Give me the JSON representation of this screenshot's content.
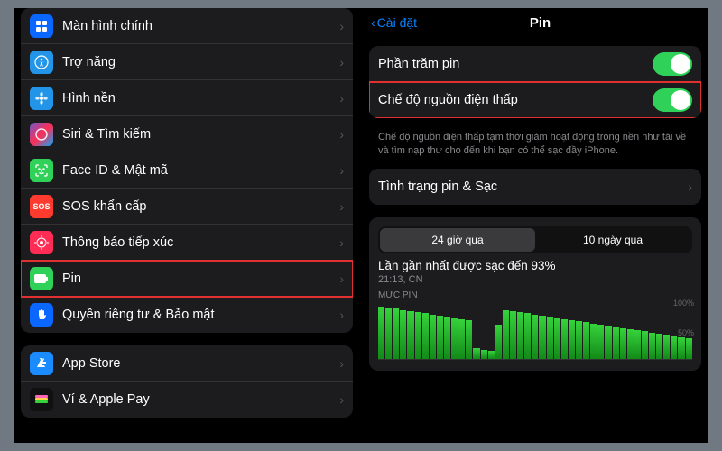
{
  "left": {
    "items": [
      {
        "label": "Màn hình chính",
        "icon": "home-grid",
        "bg": "ic-blue"
      },
      {
        "label": "Trợ năng",
        "icon": "accessibility",
        "bg": "ic-teal"
      },
      {
        "label": "Hình nền",
        "icon": "flower",
        "bg": "ic-teal"
      },
      {
        "label": "Siri & Tìm kiếm",
        "icon": "siri",
        "bg": "ic-siri"
      },
      {
        "label": "Face ID & Mật mã",
        "icon": "faceid",
        "bg": "ic-green"
      },
      {
        "label": "SOS khẩn cấp",
        "icon": "sos",
        "bg": "ic-red",
        "text": "SOS"
      },
      {
        "label": "Thông báo tiếp xúc",
        "icon": "exposure",
        "bg": "ic-pink"
      },
      {
        "label": "Pin",
        "icon": "battery",
        "bg": "ic-green",
        "highlight": true
      },
      {
        "label": "Quyền riêng tư & Bảo mật",
        "icon": "hand",
        "bg": "ic-bluehand"
      }
    ],
    "group2": [
      {
        "label": "App Store",
        "icon": "appstore",
        "bg": "ic-appstore"
      },
      {
        "label": "Ví & Apple Pay",
        "icon": "wallet",
        "bg": "ic-black"
      }
    ]
  },
  "right": {
    "back": "Cài đặt",
    "title": "Pin",
    "toggles": [
      {
        "label": "Phần trăm pin",
        "on": true
      },
      {
        "label": "Chế độ nguồn điện thấp",
        "on": true,
        "highlight": true
      }
    ],
    "footnote": "Chế độ nguồn điện thấp tạm thời giảm hoạt động trong nền như tải về và tìm nạp thư cho đến khi bạn có thể sạc đầy iPhone.",
    "health_row": "Tình trạng pin & Sạc",
    "segmented": {
      "a": "24 giờ qua",
      "b": "10 ngày qua",
      "active": "a"
    },
    "last_charge_title": "Lần gần nhất được sạc đến 93%",
    "last_charge_sub": "21:13, CN",
    "level_caption": "MỨC PIN",
    "y100": "100%",
    "y50": "50%"
  },
  "chart_data": {
    "type": "bar",
    "title": "MỨC PIN",
    "ylabel": "",
    "ylim": [
      0,
      100
    ],
    "categories": [],
    "values": [
      92,
      90,
      88,
      86,
      84,
      82,
      80,
      78,
      76,
      74,
      72,
      70,
      68,
      18,
      16,
      14,
      60,
      86,
      84,
      82,
      80,
      78,
      76,
      74,
      72,
      70,
      68,
      66,
      64,
      62,
      60,
      58,
      56,
      54,
      52,
      50,
      48,
      46,
      44,
      42,
      40,
      38,
      36
    ],
    "annotations": {
      "last_charge_pct": 93,
      "last_charge_time": "21:13, CN"
    }
  }
}
